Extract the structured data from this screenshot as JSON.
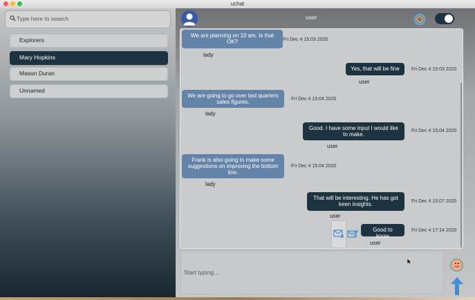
{
  "window": {
    "title": "uchat"
  },
  "sidebar": {
    "search_placeholder": "Type here to search",
    "chats": [
      {
        "label": "Explorers",
        "active": false
      },
      {
        "label": "Mary Hopkins",
        "active": true
      },
      {
        "label": "Mason Duran",
        "active": false
      },
      {
        "label": "Unnamed",
        "active": false
      }
    ]
  },
  "header": {
    "name": "user",
    "toggle_on": true
  },
  "messages": [
    {
      "text": "We are planning on 10 am. Is that OK?",
      "time": "Fri Dec 4 15:03 2020",
      "sender": "lady",
      "direction": "incoming"
    },
    {
      "text": "Yes, that will be fine",
      "time": "Fri Dec 4 15:03 2020",
      "sender": "user",
      "direction": "outgoing"
    },
    {
      "text": "We are going to go over last quarters sales figures.",
      "time": "Fri Dec 4 15:04 2020",
      "sender": "lady",
      "direction": "incoming"
    },
    {
      "text": "Good. I have some input I would like to make.",
      "time": "Fri Dec 4 15:04 2020",
      "sender": "user",
      "direction": "outgoing"
    },
    {
      "text": "Frank is also going to make some suggestions on improving the bottom line.",
      "time": "Fri Dec 4 15:04 2020",
      "sender": "lady",
      "direction": "incoming"
    },
    {
      "text": "That will be interesting. He has got keen insights.",
      "time": "Fri Dec 4 15:07 2020",
      "sender": "user",
      "direction": "outgoing"
    },
    {
      "text": "Good to know",
      "time": "Fri Dec 4 17:14 2020",
      "sender": "user",
      "direction": "outgoing",
      "status": "unsent"
    }
  ],
  "composer": {
    "placeholder": "Start typing..."
  },
  "icons": {
    "search": "search-icon",
    "avatar": "user-avatar-icon",
    "refresh": "refresh-icon",
    "toggle": "toggle-switch",
    "mail_failed": "mail-error-icon",
    "mail_edit": "mail-edit-icon",
    "emoji": "emoji-icon",
    "send": "send-arrow-icon"
  },
  "colors": {
    "incoming_bubble": "#6384a8",
    "outgoing_bubble": "#1e3340",
    "active_chat": "#1e3340",
    "accent": "#3f8fd6"
  }
}
